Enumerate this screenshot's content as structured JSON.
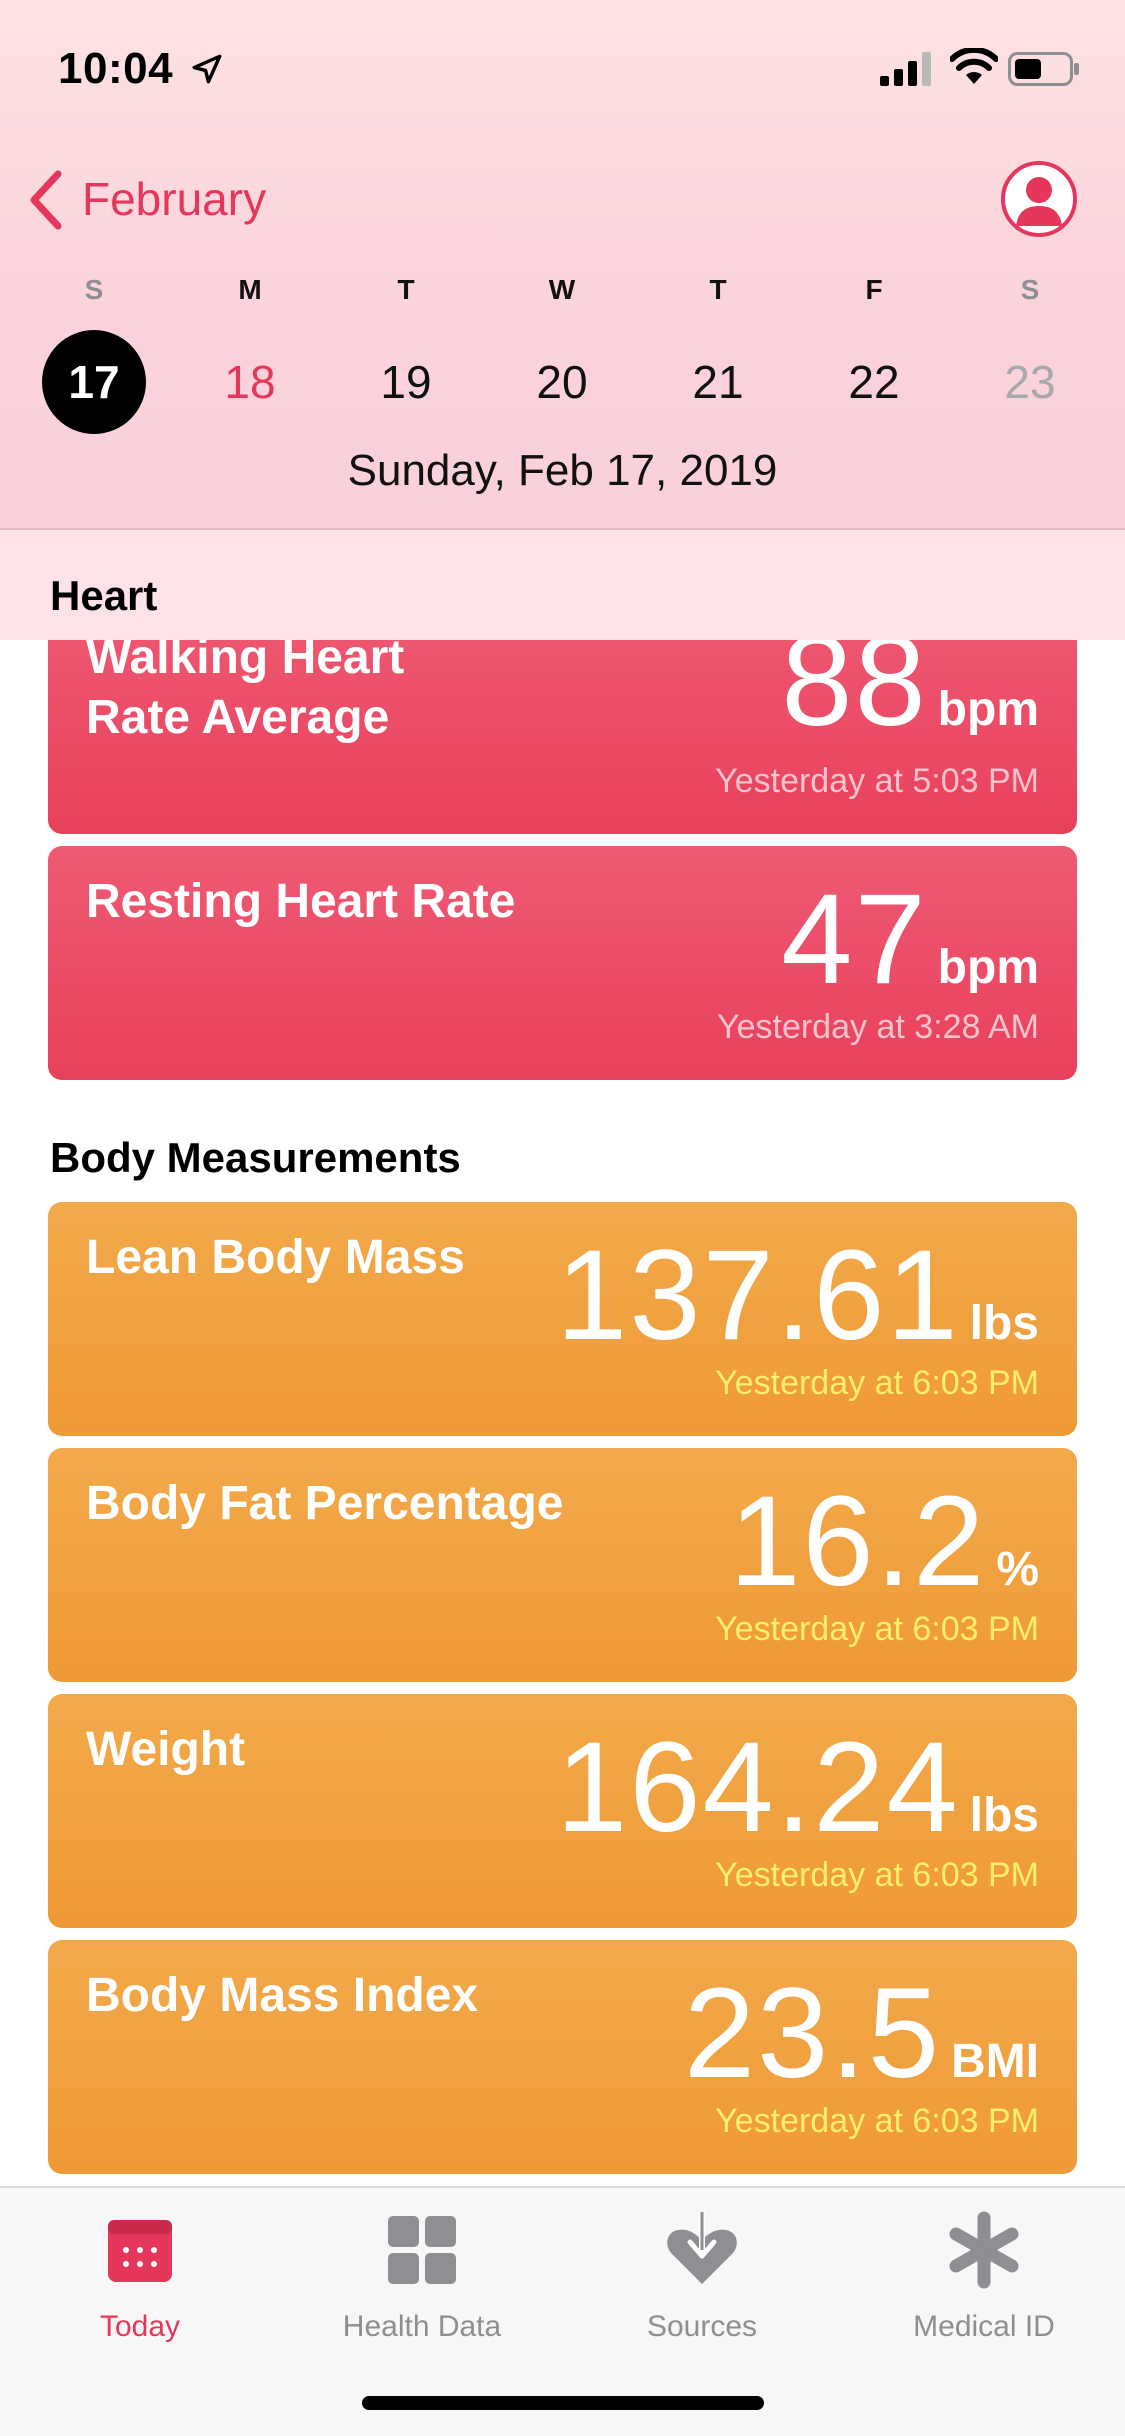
{
  "status_bar": {
    "time": "10:04"
  },
  "nav": {
    "back_label": "February"
  },
  "week": {
    "days": [
      "S",
      "M",
      "T",
      "W",
      "T",
      "F",
      "S"
    ],
    "dates": [
      "17",
      "18",
      "19",
      "20",
      "21",
      "22",
      "23"
    ],
    "selected_date": "Sunday, Feb 17, 2019"
  },
  "sections": {
    "heart": {
      "title": "Heart",
      "cards": [
        {
          "title_line1": "Walking Heart",
          "title_line2": "Rate Average",
          "value": "88",
          "unit": "bpm",
          "time": "Yesterday at 5:03 PM"
        },
        {
          "title": "Resting Heart Rate",
          "value": "47",
          "unit": "bpm",
          "time": "Yesterday at 3:28 AM"
        }
      ]
    },
    "body": {
      "title": "Body Measurements",
      "cards": [
        {
          "title": "Lean Body Mass",
          "value": "137.61",
          "unit": "lbs",
          "time": "Yesterday at 6:03 PM"
        },
        {
          "title": "Body Fat Percentage",
          "value": "16.2",
          "unit": "%",
          "time": "Yesterday at 6:03 PM"
        },
        {
          "title": "Weight",
          "value": "164.24",
          "unit": "lbs",
          "time": "Yesterday at 6:03 PM"
        },
        {
          "title": "Body Mass Index",
          "value": "23.5",
          "unit": "BMI",
          "time": "Yesterday at 6:03 PM"
        }
      ]
    }
  },
  "tabs": [
    {
      "label": "Today",
      "icon": "calendar-icon"
    },
    {
      "label": "Health Data",
      "icon": "grid-icon"
    },
    {
      "label": "Sources",
      "icon": "heart-download-icon"
    },
    {
      "label": "Medical ID",
      "icon": "asterisk-icon"
    }
  ],
  "colors": {
    "accent": "#e5375b",
    "heart_card": "#ea4a64",
    "body_card": "#f0a13f",
    "body_time": "#ffef6a"
  }
}
